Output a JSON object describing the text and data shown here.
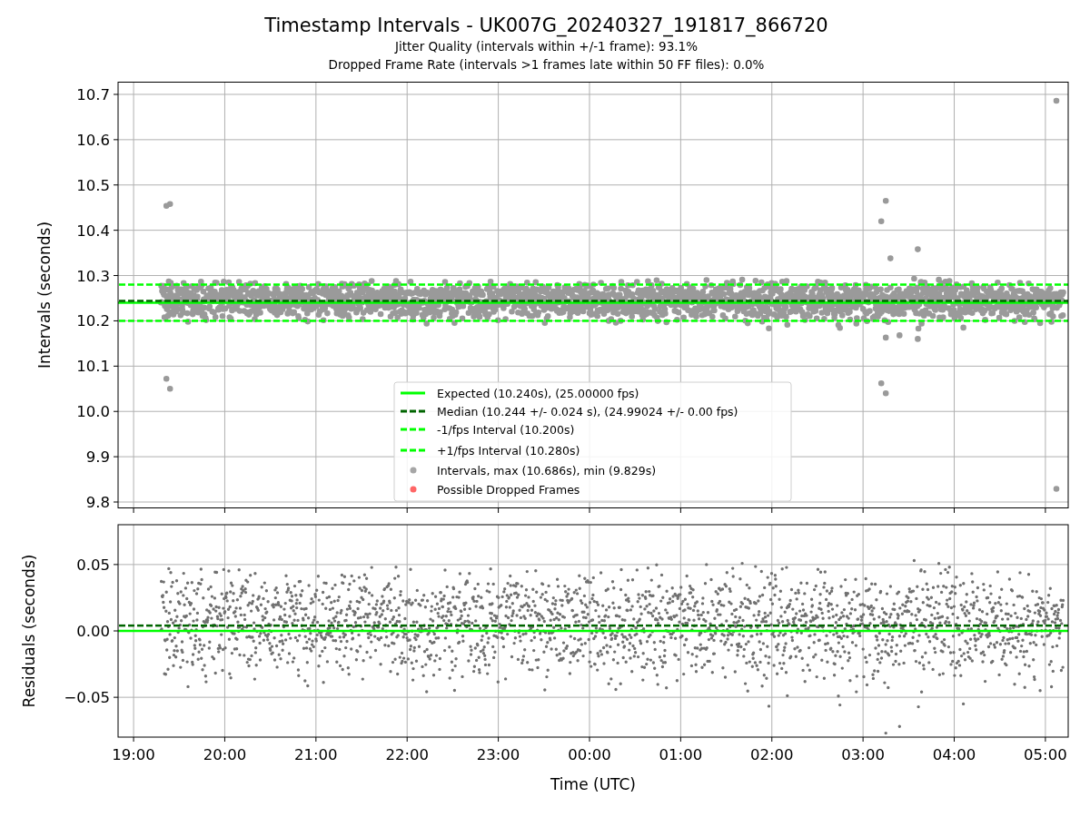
{
  "title": "Timestamp Intervals - UK007G_20240327_191817_866720",
  "subtitle_lines": [
    "Jitter Quality (intervals within +/-1 frame): 93.1%",
    "Dropped Frame Rate (intervals >1 frames late within 50 FF files): 0.0%"
  ],
  "intervals_plot": {
    "y_axis_label": "Intervals (seconds)",
    "y_tick_labels": [
      "10.7",
      "10.6",
      "10.5",
      "10.4",
      "10.3",
      "10.2",
      "10.1",
      "10.0",
      "9.9",
      "9.8"
    ],
    "legend": [
      {
        "label": "Expected (10.240s), (25.00000 fps)",
        "kind": "solid",
        "color": "#00ff00"
      },
      {
        "label": "Median (10.244 +/- 0.024 s), (24.99024 +/- 0.00 fps)",
        "kind": "dashed",
        "color": "#006400"
      },
      {
        "label": "-1/fps Interval (10.200s)",
        "kind": "dashed",
        "color": "#00ff00"
      },
      {
        "label": "+1/fps Interval (10.280s)",
        "kind": "dashed",
        "color": "#00ff00"
      },
      {
        "label": "Intervals, max (10.686s), min (9.829s)",
        "kind": "marker",
        "color": "#a6a6a6"
      },
      {
        "label": "Possible Dropped Frames",
        "kind": "marker",
        "color": "#ff6666"
      }
    ]
  },
  "residuals_plot": {
    "y_axis_label": "Residuals (seconds)",
    "y_tick_labels": [
      "0.05",
      "0.00",
      "−0.05"
    ],
    "x_tick_labels": [
      "19:00",
      "20:00",
      "21:00",
      "22:00",
      "23:00",
      "00:00",
      "01:00",
      "02:00",
      "03:00",
      "04:00",
      "05:00"
    ],
    "x_axis_label": "Time (UTC)"
  }
}
